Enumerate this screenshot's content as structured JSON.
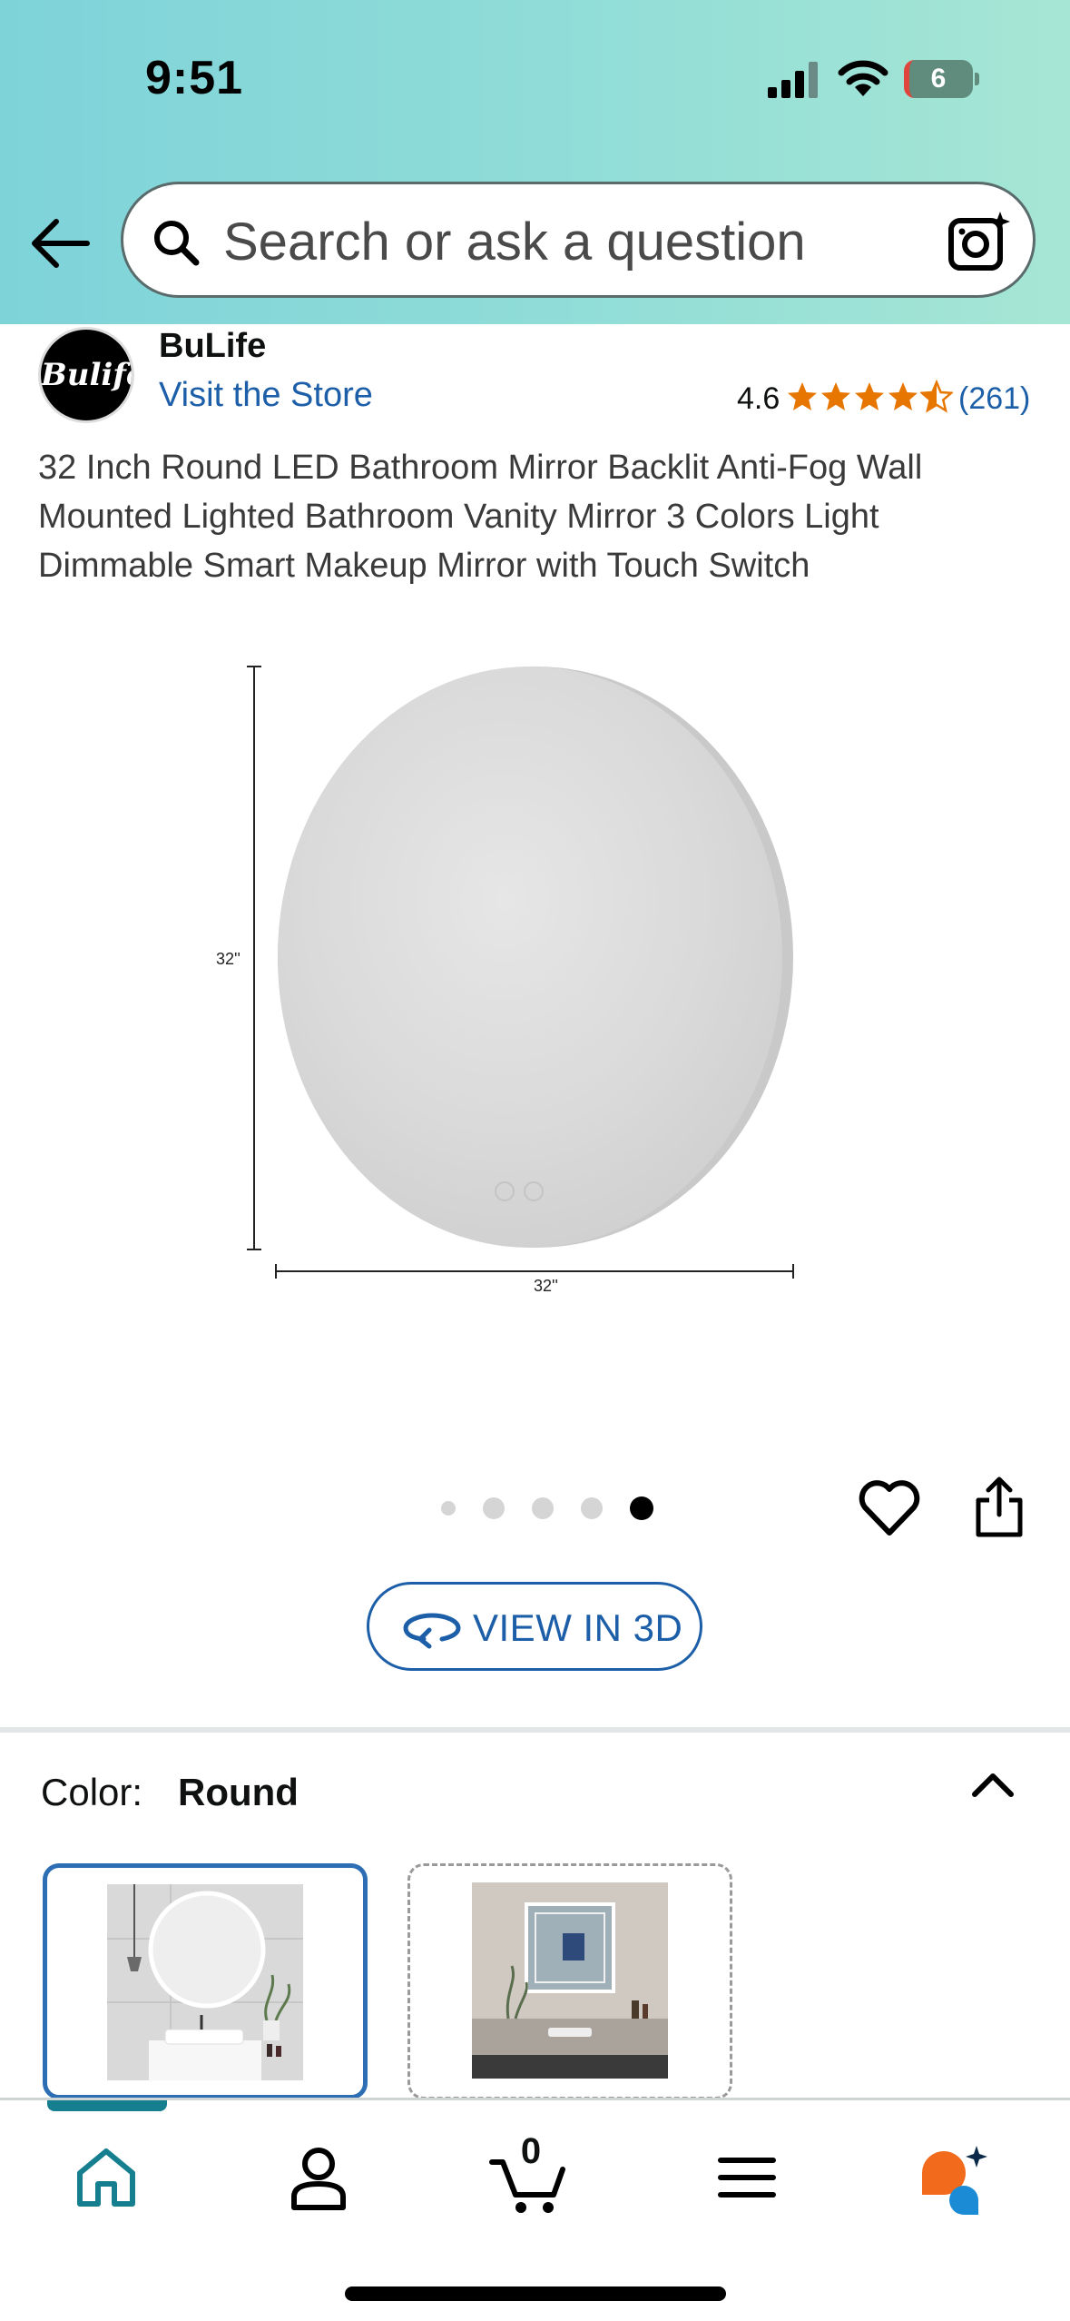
{
  "status_bar": {
    "time": "9:51",
    "battery": "6"
  },
  "search": {
    "placeholder": "Search or ask a question"
  },
  "brand": {
    "logo_text": "Bulife",
    "name": "BuLife",
    "store_link": "Visit the Store"
  },
  "rating": {
    "value": "4.6",
    "stars": 4.5,
    "count": "(261)"
  },
  "product": {
    "title": "32 Inch Round LED Bathroom Mirror Backlit Anti-Fog Wall Mounted Lighted Bathroom Vanity Mirror 3 Colors Light Dimmable Smart Makeup Mirror with Touch Switch",
    "height_label": "32''",
    "width_label": "32''"
  },
  "carousel": {
    "total": 5,
    "active_index": 4
  },
  "view_3d": {
    "label": "VIEW IN 3D"
  },
  "color_selector": {
    "label": "Color:",
    "selected": "Round",
    "options": [
      {
        "name": "Round",
        "selected": true
      },
      {
        "name": "Square",
        "selected": false
      }
    ]
  },
  "bottom_nav": {
    "items": [
      "home-icon",
      "profile-icon",
      "cart-icon",
      "menu-icon",
      "rufus-icon"
    ],
    "cart_count": "0",
    "active": "home"
  },
  "colors": {
    "accent_link": "#1c5fa8",
    "star": "#e77600",
    "nav_active": "#157f8f"
  }
}
